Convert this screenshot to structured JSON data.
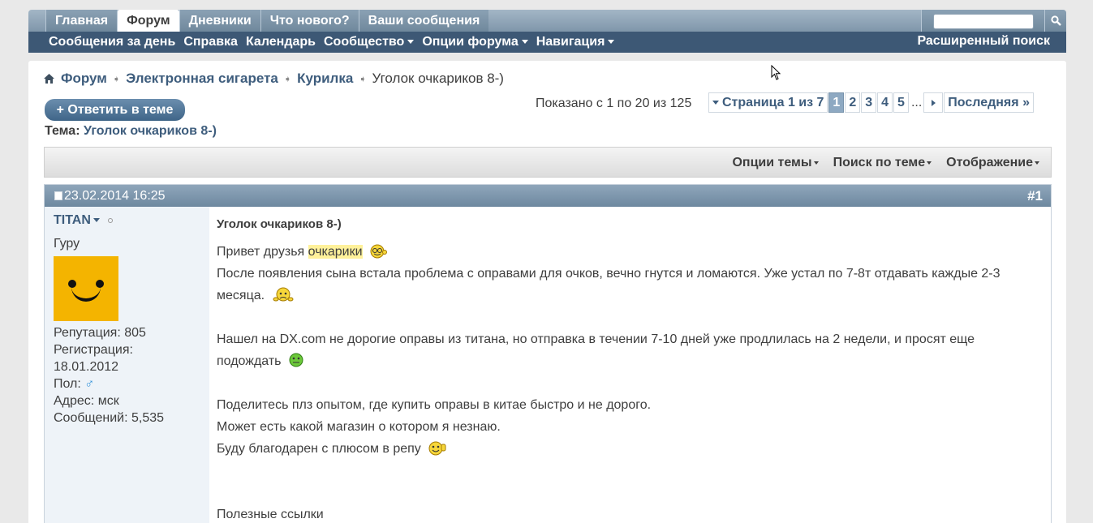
{
  "navbar": {
    "tabs": [
      "Главная",
      "Форум",
      "Дневники",
      "Что нового?",
      "Ваши сообщения"
    ],
    "active_tab": "Форум",
    "sub_links": [
      "Сообщения за день",
      "Справка",
      "Календарь",
      "Сообщество",
      "Опции форума",
      "Навигация"
    ],
    "advanced_search": "Расширенный поиск"
  },
  "breadcrumb": {
    "items": [
      "Форум",
      "Электронная сигарета",
      "Курилка"
    ],
    "current": "Уголок очкариков 8-)"
  },
  "reply_button": "+ Ответить в теме",
  "topic": {
    "label": "Тема:",
    "title": "Уголок очкариков 8-)"
  },
  "pagination": {
    "shown_text": "Показано с 1 по 20 из 125",
    "page_of": "Страница 1 из 7",
    "current_page": "1",
    "pages": [
      "1",
      "2",
      "3",
      "4",
      "5"
    ],
    "ellipsis": "...",
    "last": "Последняя"
  },
  "thread_tools": [
    "Опции темы",
    "Поиск по теме",
    "Отображение"
  ],
  "post": {
    "date": "23.02.2014 16:25",
    "number": "#1",
    "user": {
      "name": "TITAN",
      "title": "Гуру",
      "reputation": "Репутация: 805",
      "reg_label": "Регистрация:",
      "reg_date": "18.01.2012",
      "gender_label": "Пол:",
      "gender_icon": "♂",
      "address": "Адрес: мск",
      "messages": "Сообщений: 5,535"
    },
    "title": "Уголок очкариков 8-)",
    "lines": {
      "l1a": "Привет друзья ",
      "l1b": "очкарики",
      "l2": "После появления сына встала проблема с оправами для очков, вечно гнутся и ломаются. Уже устал по 7-8т отдавать каждые 2-3",
      "l3": "месяца.",
      "l4": "Нашел на DX.com не дорогие оправы из титана, но отправка в течении 7-10 дней уже продлилась на 2 недели, и просят еще",
      "l5": "подождать",
      "l6": "Поделитесь плз опытом, где купить оправы в китае быстро и не дорого.",
      "l7": "Может есть какой магазин о котором я незнаю.",
      "l8": "Буду благодарен с плюсом в репу",
      "l9": "Полезные ссылки"
    }
  }
}
